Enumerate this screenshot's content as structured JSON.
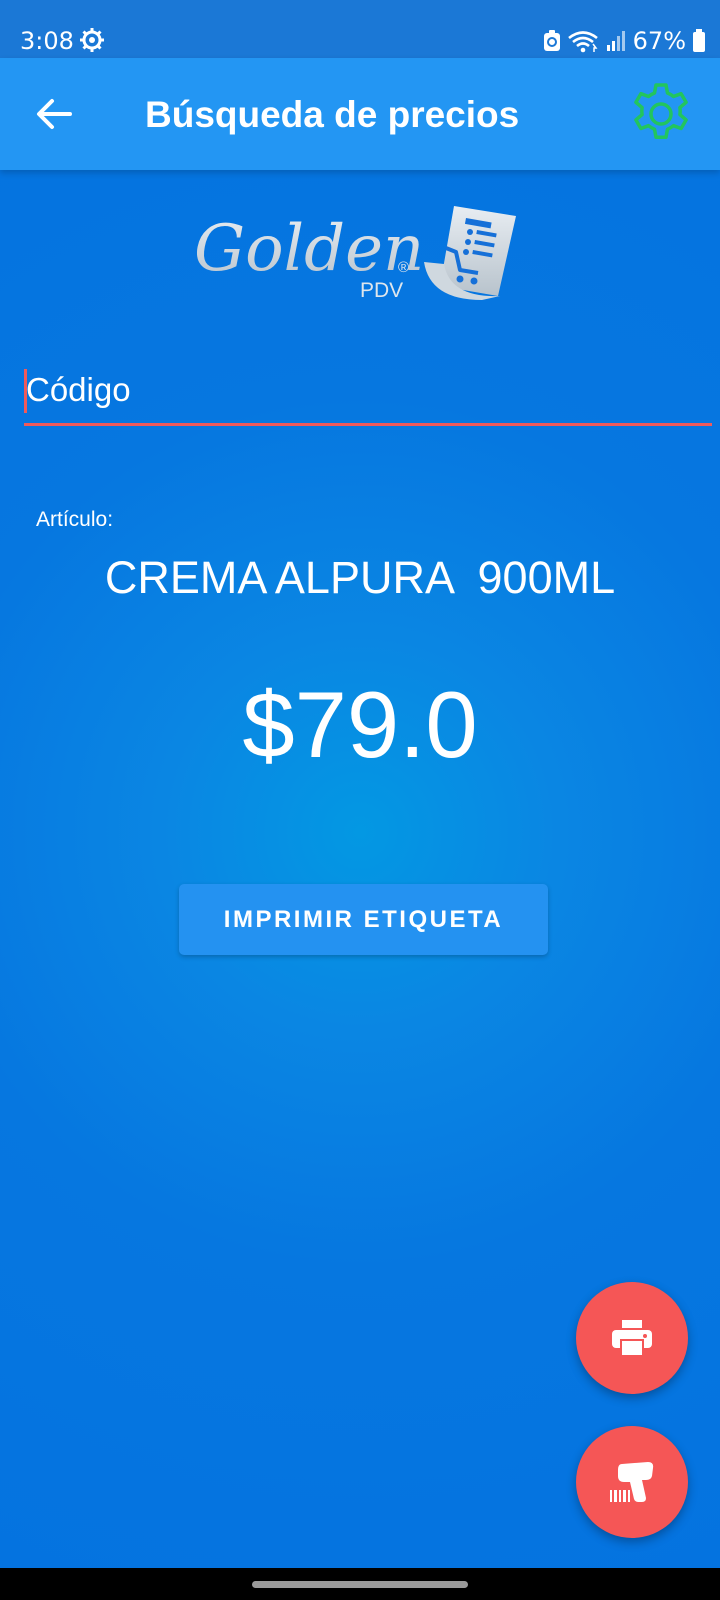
{
  "status_bar": {
    "time": "3:08",
    "battery": "67%",
    "icons": [
      "settings-gear-icon",
      "recycle-battery-saver-icon",
      "wifi-icon",
      "signal-icon",
      "battery-icon"
    ]
  },
  "app_bar": {
    "title": "Búsqueda de precios",
    "back_icon": "arrow-left-icon",
    "settings_icon": "gear-icon",
    "settings_color": "#22c55e"
  },
  "logo": {
    "text": "Golden",
    "sub": "PDV",
    "mark": "®"
  },
  "search": {
    "placeholder": "Código",
    "value": ""
  },
  "item": {
    "label": "Artículo:",
    "name": "CREMA ALPURA  900ML",
    "price": "$79.0"
  },
  "actions": {
    "print_label": "IMPRIMIR ETIQUETA",
    "fab_print_icon": "printer-icon",
    "fab_scan_icon": "barcode-scanner-icon"
  },
  "colors": {
    "accent": "#f55656",
    "app_bar": "#2396f3",
    "background": "#0677e0"
  }
}
